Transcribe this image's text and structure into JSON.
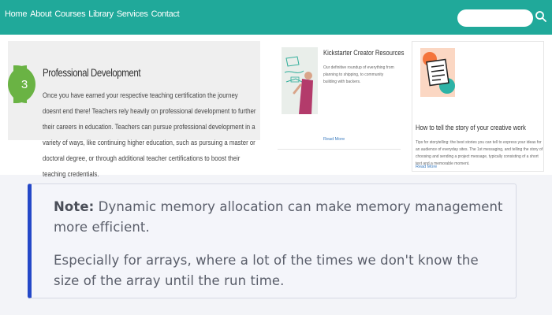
{
  "nav": {
    "links": [
      "Home",
      "About",
      "Courses",
      "Library",
      "Services",
      "Contact"
    ],
    "search_placeholder": ""
  },
  "professional_development": {
    "step": "3",
    "title": "Professional Development",
    "body": "Once you have earned your respective teaching certification the journey doesnt end there! Teachers rely heavily on professional development to further their careers in education. Teachers can pursue professional development in a variety of ways, like continuing higher education, such as pursuing a master or doctoral degree, or through additional teacher certifications to boost their teaching credentials."
  },
  "cards": [
    {
      "title": "Kickstarter Creator Resources",
      "description": "Our definitive roundup of everything from planning to shipping, to community building with backers.",
      "link": "Read More"
    },
    {
      "title": "How to tell the story of your creative work",
      "description": "Tips for storytelling: the best stories you can tell to express your ideas for an audience of everyday sites. The 1st messaging, and telling the story of choosing and sending a project message, typically consisting of a short text and a memorable moment.",
      "link": "Read More"
    }
  ],
  "note": {
    "label": "Note:",
    "line1": " Dynamic memory allocation can make memory management more efficient.",
    "line2": "Especially for arrays, where a lot of the times we don't know the size of the array until the run time."
  },
  "colors": {
    "nav_bg": "#20a99a",
    "step_badge": "#6ab344",
    "note_accent": "#2448c8"
  }
}
